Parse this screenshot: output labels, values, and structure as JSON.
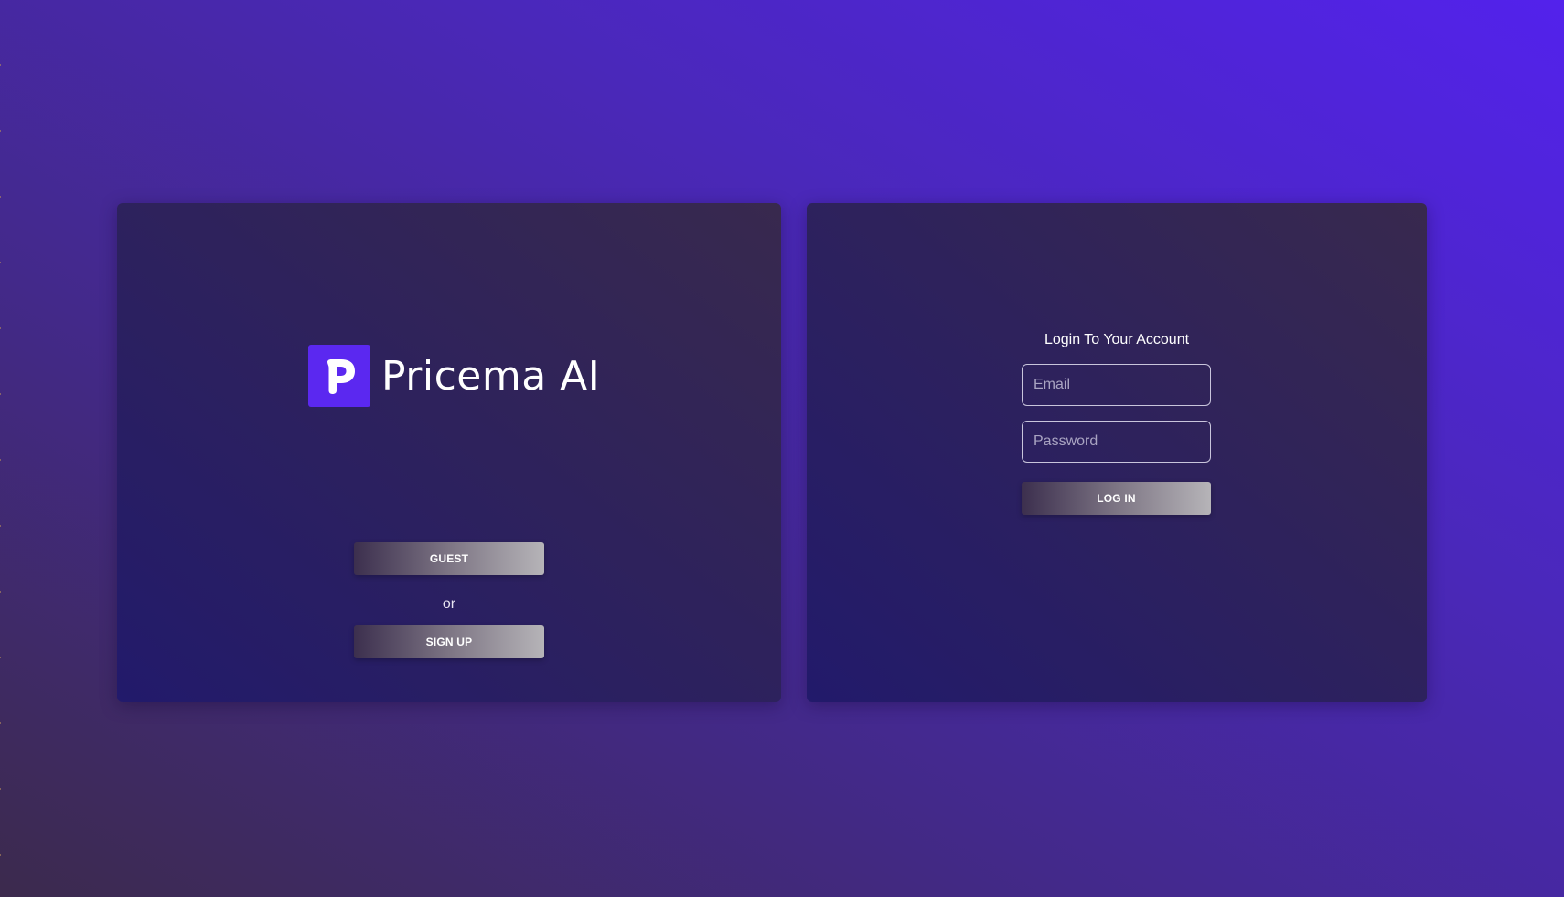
{
  "brand": {
    "name": "Pricema AI",
    "badge_letter": "P",
    "badge_color": "#5b28f0"
  },
  "welcome": {
    "guest_label": "GUEST",
    "or_label": "or",
    "signup_label": "SIGN UP"
  },
  "login": {
    "title": "Login To Your Account",
    "email_placeholder": "Email",
    "email_value": "",
    "password_placeholder": "Password",
    "password_value": "",
    "submit_label": "LOG IN"
  },
  "theme": {
    "background_start": "#3c2a4d",
    "background_end": "#5322ec",
    "panel_color": "#2b2060",
    "accent": "#5b28f0"
  }
}
